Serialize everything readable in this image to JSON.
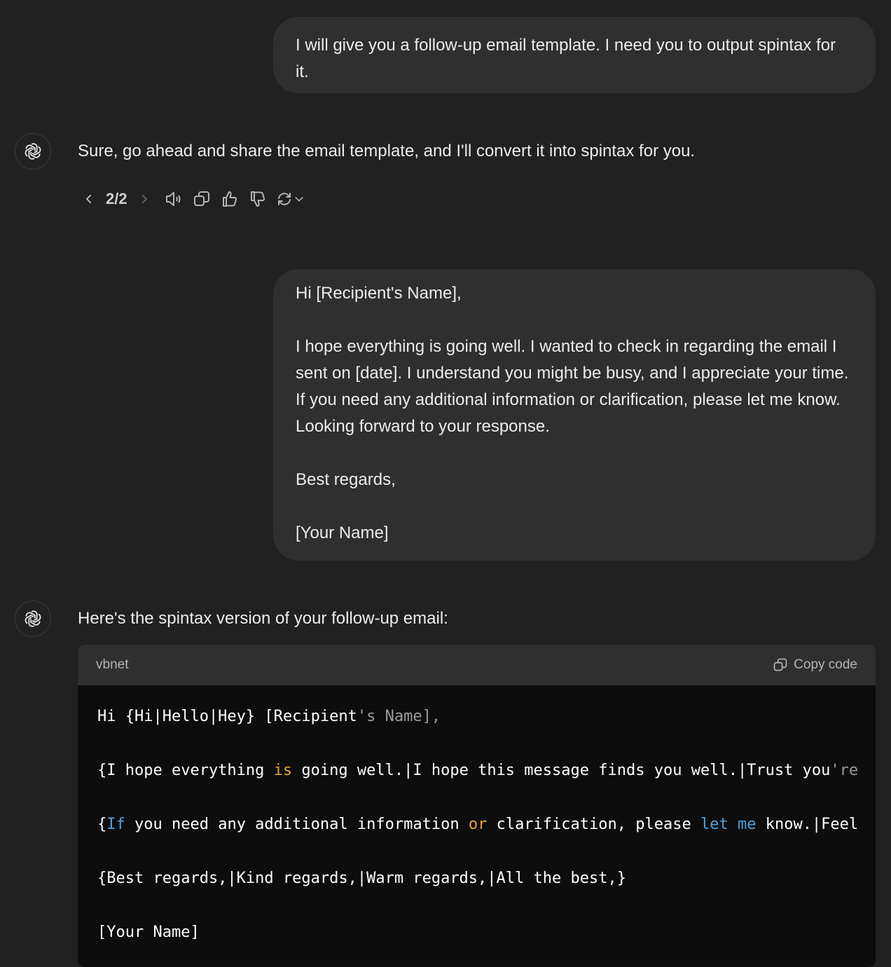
{
  "conversation": {
    "user_message_1": "I will give you a follow-up email template. I need you to output spintax for it.",
    "assistant_message_1": "Sure, go ahead and share the email template, and I'll convert it into spintax for you.",
    "assistant_actions": {
      "pager": "2/2",
      "icons": [
        "chevron-left-icon",
        "chevron-right-icon",
        "read-aloud-icon",
        "copy-icon",
        "thumbs-up-icon",
        "thumbs-down-icon",
        "regenerate-icon",
        "chevron-down-icon"
      ]
    },
    "user_message_2": {
      "lines": [
        "Hi [Recipient's Name],",
        "",
        "I hope everything is going well. I wanted to check in regarding the email I sent on [date]. I understand you might be busy, and I appreciate your time. If you need any additional information or clarification, please let me know. Looking forward to your response.",
        "",
        "Best regards,",
        "",
        "[Your Name]"
      ]
    },
    "assistant_message_2": "Here's the spintax version of your follow-up email:",
    "code_block": {
      "language": "vbnet",
      "copy_label": "Copy code",
      "lines": [
        [
          [
            "Hi {Hi|Hello|Hey} [Recipient",
            ""
          ],
          [
            "'s Name],",
            "gray"
          ]
        ],
        [],
        [
          [
            "{I hope everything ",
            ""
          ],
          [
            "is",
            "orange"
          ],
          [
            " going well.|I hope this message finds you well.|Trust you",
            ""
          ],
          [
            "'re",
            "gray"
          ]
        ],
        [],
        [
          [
            "{",
            ""
          ],
          [
            "If",
            "blue"
          ],
          [
            " you need any additional information ",
            ""
          ],
          [
            "or",
            "orange"
          ],
          [
            " clarification, please ",
            ""
          ],
          [
            "let",
            "blue"
          ],
          [
            " ",
            ""
          ],
          [
            "me",
            "blue"
          ],
          [
            " know.|Feel",
            ""
          ]
        ],
        [],
        [
          [
            "{Best regards,|Kind regards,|Warm regards,|All the best,}",
            ""
          ]
        ],
        [],
        [
          [
            "[Your Name]",
            ""
          ]
        ]
      ]
    }
  },
  "colors": {
    "background": "#212121",
    "bubble": "#2f2f2f",
    "code_bg": "#0d0d0d",
    "keyword_orange": "#e1a23f",
    "keyword_blue": "#4ea1e3"
  }
}
